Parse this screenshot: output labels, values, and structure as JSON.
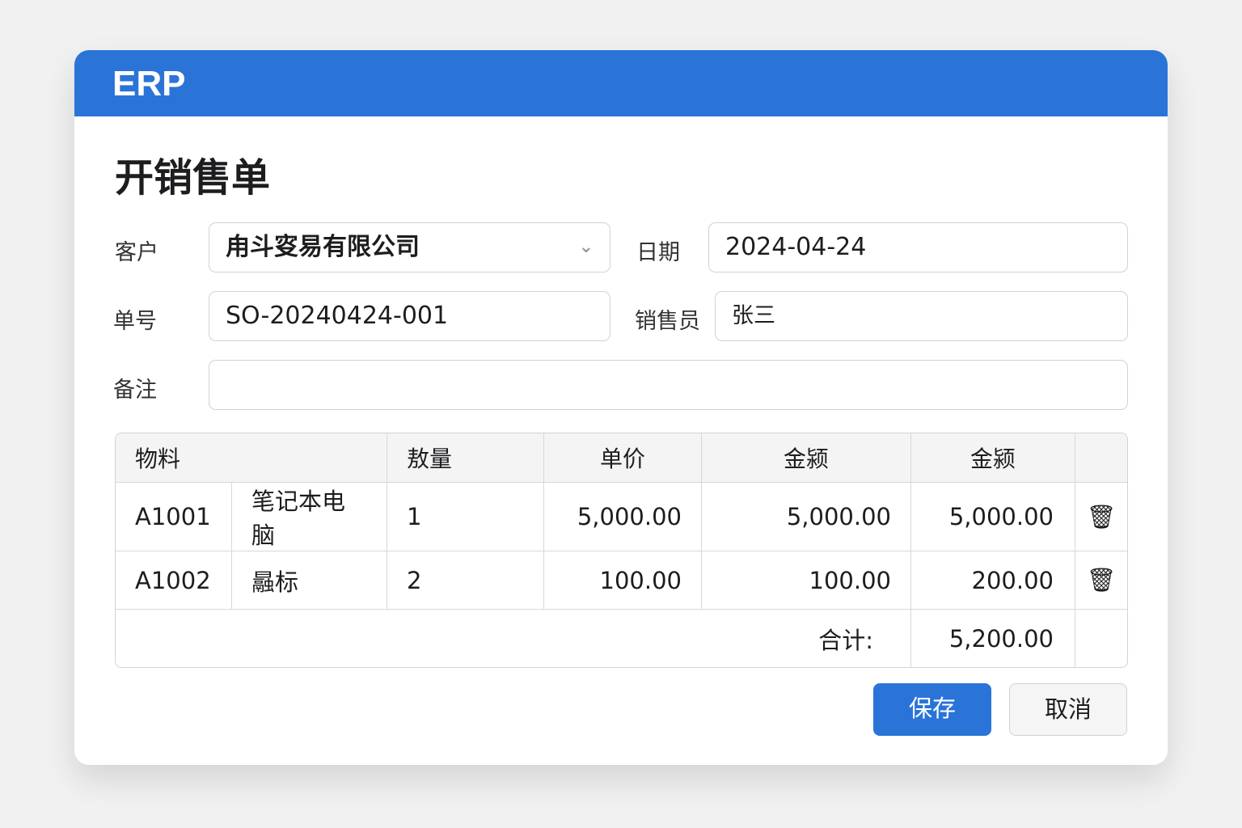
{
  "app": {
    "title": "ERP"
  },
  "page": {
    "title": "开销售单"
  },
  "form": {
    "customer_label": "客户",
    "customer_value": "甪斗叜易有限公司",
    "date_label": "日期",
    "date_value": "2024-04-24",
    "order_no_label": "单号",
    "order_no_value": "SO-20240424-001",
    "salesperson_label": "销售员",
    "salesperson_value": "张三",
    "remark_label": "备注",
    "remark_value": ""
  },
  "table": {
    "headers": [
      "物料",
      "敖量",
      "单价",
      "金颍",
      "金颍"
    ],
    "rows": [
      {
        "code": "A1001",
        "name": "笔记本电脑",
        "qty": "1",
        "price": "5,000.00",
        "amount1": "5,000.00",
        "amount2": "5,000.00"
      },
      {
        "code": "A1002",
        "name": "曧标",
        "qty": "2",
        "price": "100.00",
        "amount1": "100.00",
        "amount2": "200.00"
      }
    ],
    "total_label": "合计:",
    "total_value": "5,200.00"
  },
  "buttons": {
    "save": "保存",
    "cancel": "取消"
  },
  "colors": {
    "accent": "#2a74d8"
  }
}
